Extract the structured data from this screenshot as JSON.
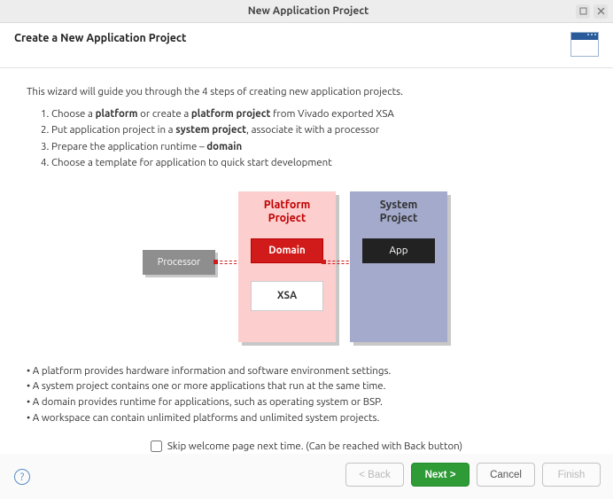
{
  "window": {
    "title": "New Application Project"
  },
  "header": {
    "title": "Create a New Application Project"
  },
  "intro": "This wizard will guide you through the 4 steps of creating new application projects.",
  "steps": {
    "s1_a": "Choose a ",
    "s1_b": "platform",
    "s1_c": " or create a ",
    "s1_d": "platform project",
    "s1_e": " from Vivado exported XSA",
    "s2_a": "Put application project in a ",
    "s2_b": "system project",
    "s2_c": ", associate it with a processor",
    "s3_a": "Prepare the application runtime – ",
    "s3_b": "domain",
    "s4": "Choose a template for application to quick start development"
  },
  "diagram": {
    "processor": "Processor",
    "platform_l1": "Platform",
    "platform_l2": "Project",
    "domain": "Domain",
    "xsa": "XSA",
    "system_l1": "System",
    "system_l2": "Project",
    "app": "App"
  },
  "bullets": {
    "b1": "• A platform provides hardware information and software environment settings.",
    "b2": "• A system project contains one or more applications that run at the same time.",
    "b3": "• A domain provides runtime for applications, such as operating system or BSP.",
    "b4": "• A workspace can contain unlimited platforms and unlimited system projects."
  },
  "skip": {
    "label": "Skip welcome page next time. (Can be reached with Back button)",
    "checked": false
  },
  "buttons": {
    "help": "?",
    "back": "< Back",
    "next": "Next >",
    "cancel": "Cancel",
    "finish": "Finish"
  }
}
